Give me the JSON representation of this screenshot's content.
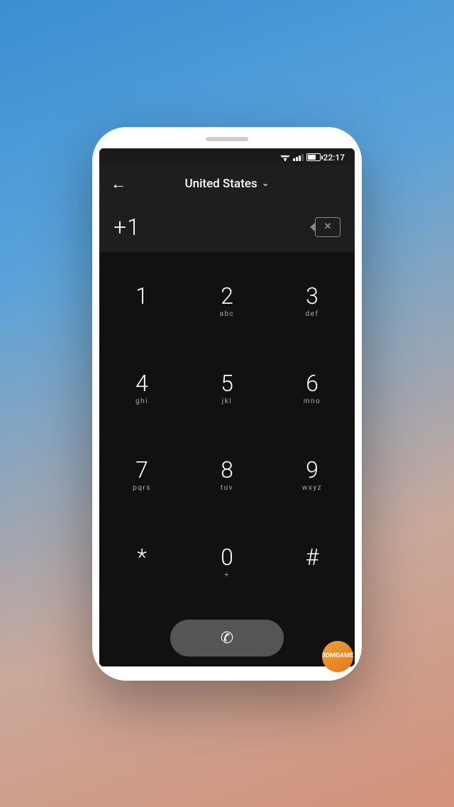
{
  "statusBar": {
    "time": "22:17"
  },
  "navBar": {
    "backLabel": "←",
    "countryName": "United States",
    "chevron": "∨"
  },
  "numberDisplay": {
    "number": "+1",
    "backspaceLabel": "⌫"
  },
  "dialpad": {
    "rows": [
      [
        {
          "number": "1",
          "letters": ""
        },
        {
          "number": "2",
          "letters": "abc"
        },
        {
          "number": "3",
          "letters": "def"
        }
      ],
      [
        {
          "number": "4",
          "letters": "ghi"
        },
        {
          "number": "5",
          "letters": "jkl"
        },
        {
          "number": "6",
          "letters": "mno"
        }
      ],
      [
        {
          "number": "7",
          "letters": "pqrs"
        },
        {
          "number": "8",
          "letters": "tuv"
        },
        {
          "number": "9",
          "letters": "wxyz"
        }
      ],
      [
        {
          "number": "*",
          "letters": ""
        },
        {
          "number": "0",
          "letters": "+"
        },
        {
          "number": "#",
          "letters": ""
        }
      ]
    ]
  },
  "callButton": {
    "icon": "📞"
  },
  "watermark": {
    "text": "3DMGAME"
  }
}
